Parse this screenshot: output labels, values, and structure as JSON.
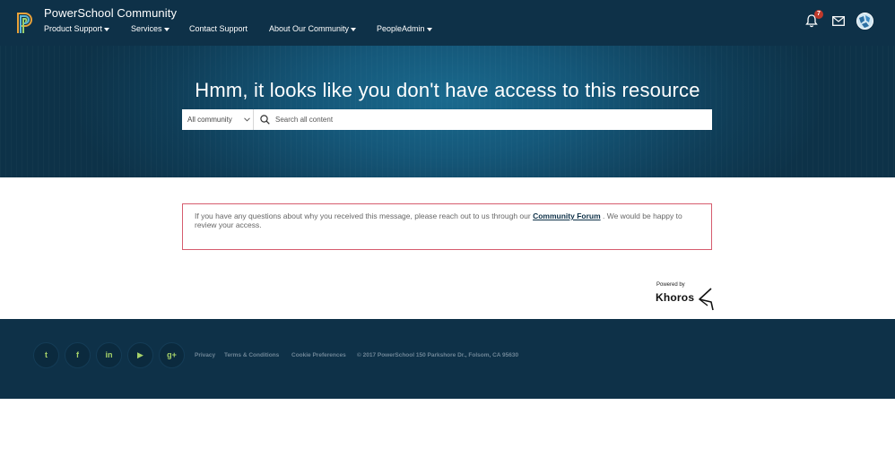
{
  "header": {
    "brand": "PowerSchool Community",
    "nav": [
      {
        "label": "Product Support",
        "dropdown": true
      },
      {
        "label": "Services",
        "dropdown": true
      },
      {
        "label": "Contact Support",
        "dropdown": false
      },
      {
        "label": "About Our Community",
        "dropdown": true
      },
      {
        "label": "PeopleAdmin",
        "dropdown": true
      }
    ],
    "notifications_count": "7",
    "icons": [
      "bell-icon",
      "mail-icon",
      "avatar"
    ]
  },
  "hero": {
    "title": "Hmm, it looks like you don't have access to this resource",
    "search_scope": "All community",
    "search_placeholder": "Search all content"
  },
  "message": {
    "text_before": "If you have any questions about why you received this message, please reach out to us through our ",
    "link": "Community Forum",
    "text_after": " . We would be happy to review your access."
  },
  "powered_by": {
    "label": "Powered by",
    "brand": "Khoros"
  },
  "footer": {
    "social": [
      {
        "name": "twitter",
        "glyph": "t"
      },
      {
        "name": "facebook",
        "glyph": "f"
      },
      {
        "name": "linkedin",
        "glyph": "in"
      },
      {
        "name": "youtube",
        "glyph": "▶"
      },
      {
        "name": "google-plus",
        "glyph": "g+"
      }
    ],
    "links": [
      "Privacy",
      "Terms & Conditions",
      "Cookie Preferences"
    ],
    "copyright": "© 2017 PowerSchool 150 Parkshore Dr., Folsom, CA 95630"
  },
  "colors": {
    "topbar": "#0e3148",
    "accent_social": "#a7d36a",
    "alert_border": "#d65c6e",
    "badge": "#c0392b"
  }
}
